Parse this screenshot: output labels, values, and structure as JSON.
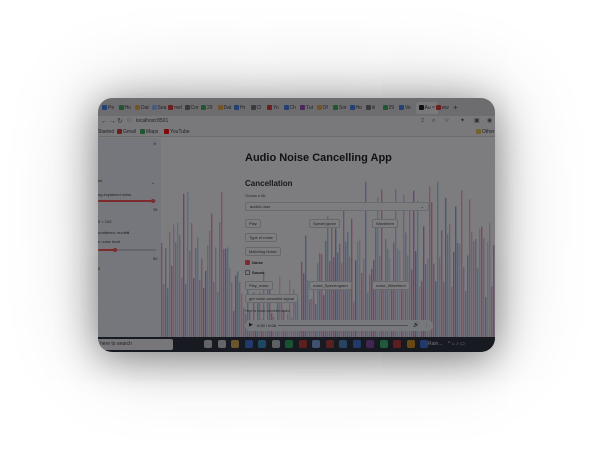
{
  "browser": {
    "tabs": [
      "Pe",
      "Ho",
      "Dat",
      "Sea",
      "mel",
      "Cor",
      "29",
      "Dat",
      "Hr",
      "Cl",
      "Yo",
      "Ch",
      "Tut",
      "Of",
      "Sor",
      "Ho",
      "iii",
      "29",
      "Ve",
      "Au",
      "ww"
    ],
    "active_tab": "Au",
    "active_tab_close": "×",
    "new_tab": "+",
    "url": "localhost:8501",
    "bookmarks": [
      {
        "label": "Started",
        "color": "#e8a33d"
      },
      {
        "label": "Gmail",
        "color": "#d93025"
      },
      {
        "label": "Maps",
        "color": "#34a853"
      },
      {
        "label": "YouTube",
        "color": "#ff0000"
      }
    ],
    "other_bookmarks": "Other"
  },
  "sidebar": {
    "close": "×",
    "select1_value": "es",
    "slider1_label": "ng explained noise",
    "slider1_fraction": 0.95,
    "slider1_value": "35",
    "label2": "0 = 100",
    "label3": "unaltered: modes",
    "label3_value": "5",
    "slider2_label": "n noise level",
    "slider2_fraction": 0.3,
    "slider2_value": "50",
    "label4": "5"
  },
  "main": {
    "title": "Audio Noise Cancelling App",
    "subtitle": "Cancellation",
    "choose_label": "Choose a file",
    "select_value": "audio1.wav",
    "buttons_row1": [
      "Play",
      "Spectrogram",
      "Waveform"
    ],
    "type_noise_button": "Type of noise",
    "matching_noise_button": "Matching Noise",
    "check1": "Noise",
    "check2": "Sound",
    "check1_checked": true,
    "check2_checked": false,
    "buttons_row2": [
      "Play_noise",
      "noise_Spectrogram",
      "noise_Waveform"
    ],
    "get_noise_button": "get noise canceled signal",
    "result_label": "Here is noise canceled audio",
    "audio": {
      "time": "0:00 / 0:08",
      "play": "▶",
      "volume": "🔊",
      "more": "⋮"
    }
  },
  "taskbar": {
    "search_placeholder": "here to search",
    "tray_text": "Rain...",
    "tray_icons": "^ ⌂ ♪ ▭"
  },
  "colors": {
    "accent": "#ff4b4b",
    "wave_colors": [
      "#e8407a",
      "#b24fd0",
      "#4a7bd8",
      "#46b0e0",
      "#f06aa8"
    ]
  }
}
